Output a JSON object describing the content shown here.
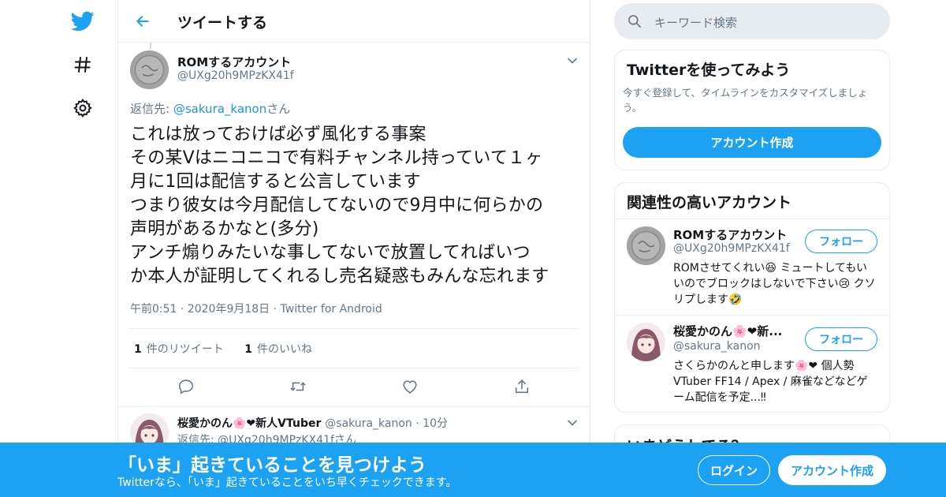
{
  "colors": {
    "brand": "#1da1f2",
    "text": "#14171a",
    "muted": "#657786",
    "border": "#e6ecf0"
  },
  "nav": {
    "icons": [
      "twitter-bird-icon",
      "hashtag-icon",
      "gear-icon"
    ]
  },
  "header": {
    "title": "ツイートする",
    "back_icon": "arrow-left-icon"
  },
  "tweet": {
    "author_name": "ROMするアカウント",
    "author_handle": "@UXg20h9MPzKX41f",
    "reply_prefix": "返信先: ",
    "reply_handle": "@sakura_kanon",
    "reply_suffix": "さん",
    "body": "これは放っておけば必ず風化する事案\nその某Vはニコニコで有料チャンネル持っていて１ヶ\n月に1回は配信すると公言しています\nつまり彼女は今月配信してないので9月中に何らかの\n声明があるかなと(多分)\nアンチ煽りみたいな事してないで放置してればいつ\nか本人が証明してくれるし売名疑惑もみんな忘れます",
    "time": "午前0:51",
    "date": "2020年9月18日",
    "source": "Twitter for Android",
    "retweet_count": "1",
    "retweet_label": "件のリツイート",
    "like_count": "1",
    "like_label": "件のいいね",
    "action_icons": [
      "reply-icon",
      "retweet-icon",
      "like-icon",
      "share-icon"
    ]
  },
  "reply": {
    "name": "桜愛かのん🌸❤新人VTuber",
    "handle": "@sakura_kanon",
    "time": "10分",
    "sub": "返信先: @UXg20h9MPzKX41fさん"
  },
  "search": {
    "placeholder": "キーワード検索"
  },
  "signup_card": {
    "title": "Twitterを使ってみよう",
    "description": "今すぐ登録して、タイムラインをカスタマイズしましょう。",
    "button": "アカウント作成"
  },
  "related": {
    "title": "関連性の高いアカウント",
    "accounts": [
      {
        "name": "ROMするアカウント",
        "handle": "@UXg20h9MPzKX41f",
        "bio": "ROMさせてくれい😆 ミュートしてもいいのでブロックはしないで下さい😢 クソリプします🤣",
        "follow": "フォロー"
      },
      {
        "name": "桜愛かのん🌸❤新...",
        "handle": "@sakura_kanon",
        "bio": "さくらかのんと申します🌸❤ 個人勢VTuber FF14 / Apex / 麻雀などなどゲーム配信を予定...‼",
        "follow": "フォロー"
      }
    ]
  },
  "trends": {
    "title": "いまどうしてる？"
  },
  "banner": {
    "title": "「いま」起きていることを見つけよう",
    "subtitle": "Twitterなら、「いま」起きていることをいち早くチェックできます。",
    "login": "ログイン",
    "signup": "アカウント作成"
  }
}
